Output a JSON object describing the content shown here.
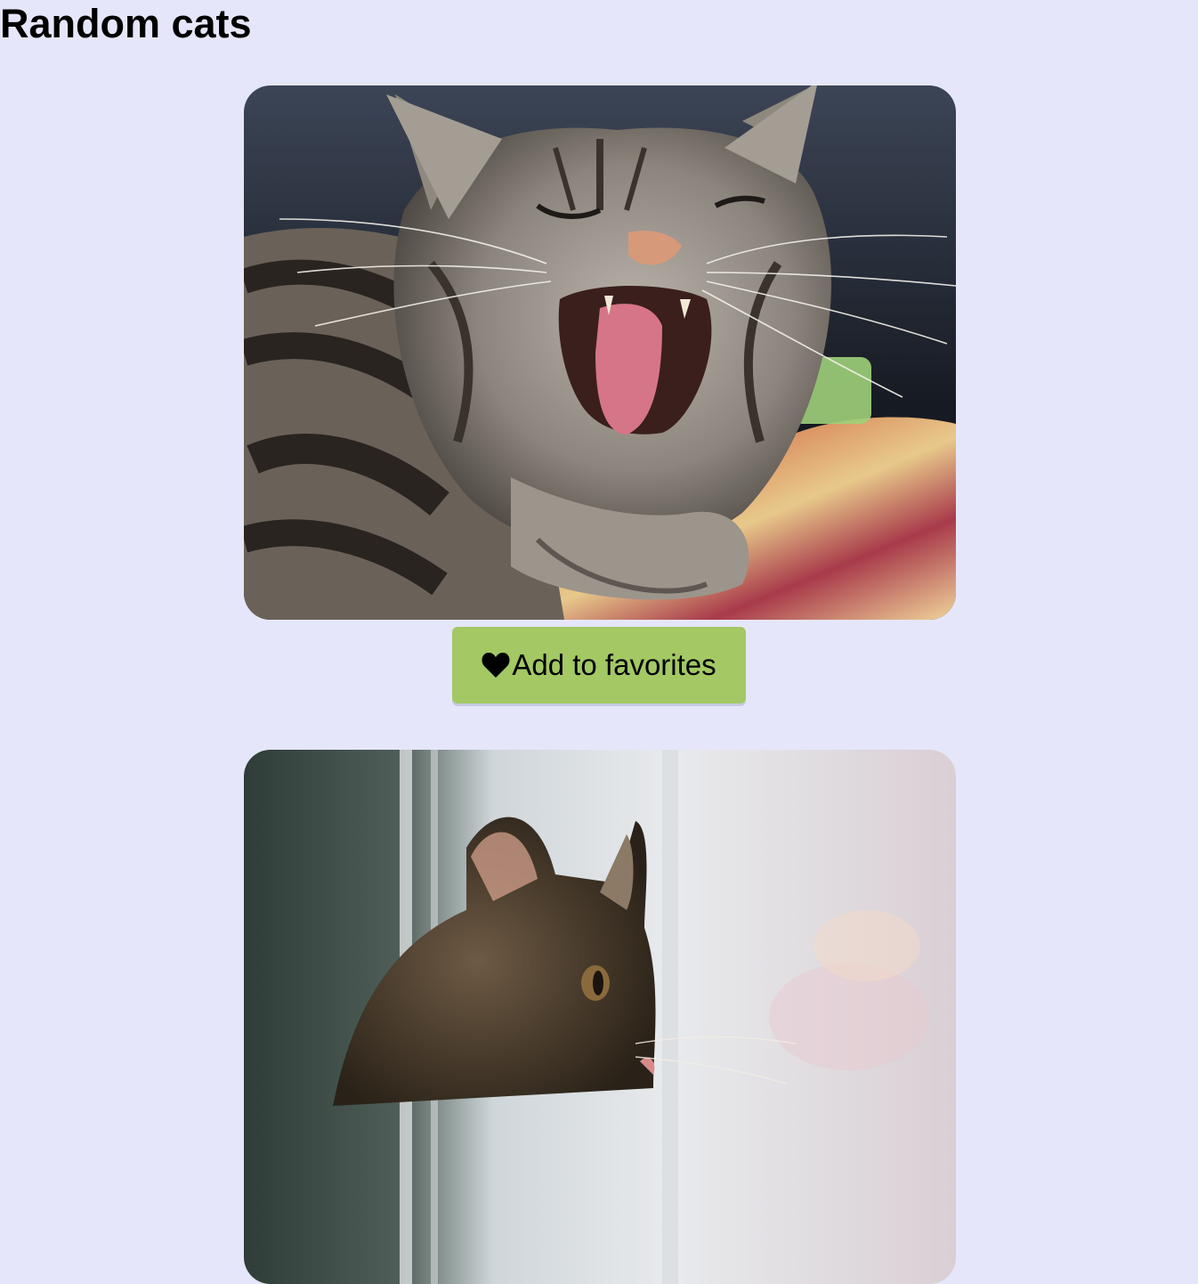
{
  "page": {
    "title": "Random cats",
    "background": "#e6e6fa"
  },
  "cards": [
    {
      "image_subject": "yawning tabby cat lying on a patterned cushion",
      "favorite_label": "Add to favorites",
      "favorite_icon": "heart-icon",
      "button_color": "#a3c864"
    },
    {
      "image_subject": "tabby cat looking out a window"
    }
  ]
}
